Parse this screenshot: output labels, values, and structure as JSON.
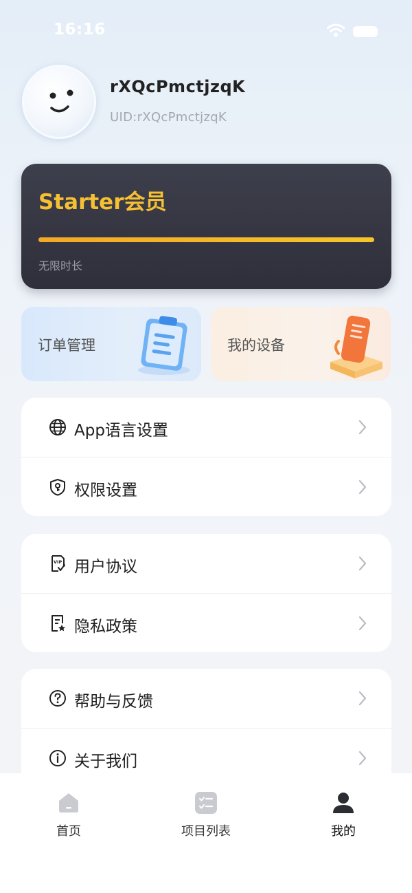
{
  "status_bar": {
    "time": "16:16"
  },
  "profile": {
    "name": "rXQcPmctjzqK",
    "uid": "UID:rXQcPmctjzqK"
  },
  "membership": {
    "title": "Starter会员",
    "subtitle": "无限时长",
    "progress": 1.0
  },
  "quick_actions": [
    {
      "label": "订单管理",
      "icon": "clipboard-icon"
    },
    {
      "label": "我的设备",
      "icon": "device-icon"
    }
  ],
  "settings_group": [
    {
      "label": "App语言设置",
      "icon": "globe-icon"
    },
    {
      "label": "权限设置",
      "icon": "shield-key-icon"
    }
  ],
  "legal_group": [
    {
      "label": "用户协议",
      "icon": "vip-document-icon"
    },
    {
      "label": "隐私政策",
      "icon": "document-star-icon"
    }
  ],
  "support_group": [
    {
      "label": "帮助与反馈",
      "icon": "question-circle-icon"
    },
    {
      "label": "关于我们",
      "icon": "info-circle-icon"
    }
  ],
  "tabbar": [
    {
      "label": "首页",
      "icon": "home-icon",
      "active": false
    },
    {
      "label": "项目列表",
      "icon": "checklist-icon",
      "active": false
    },
    {
      "label": "我的",
      "icon": "user-icon",
      "active": true
    }
  ],
  "colors": {
    "gold": "#f6c033",
    "card_dark": "#343541",
    "inactive_icon": "#c9cbd0",
    "active_icon": "#2b2d33"
  }
}
